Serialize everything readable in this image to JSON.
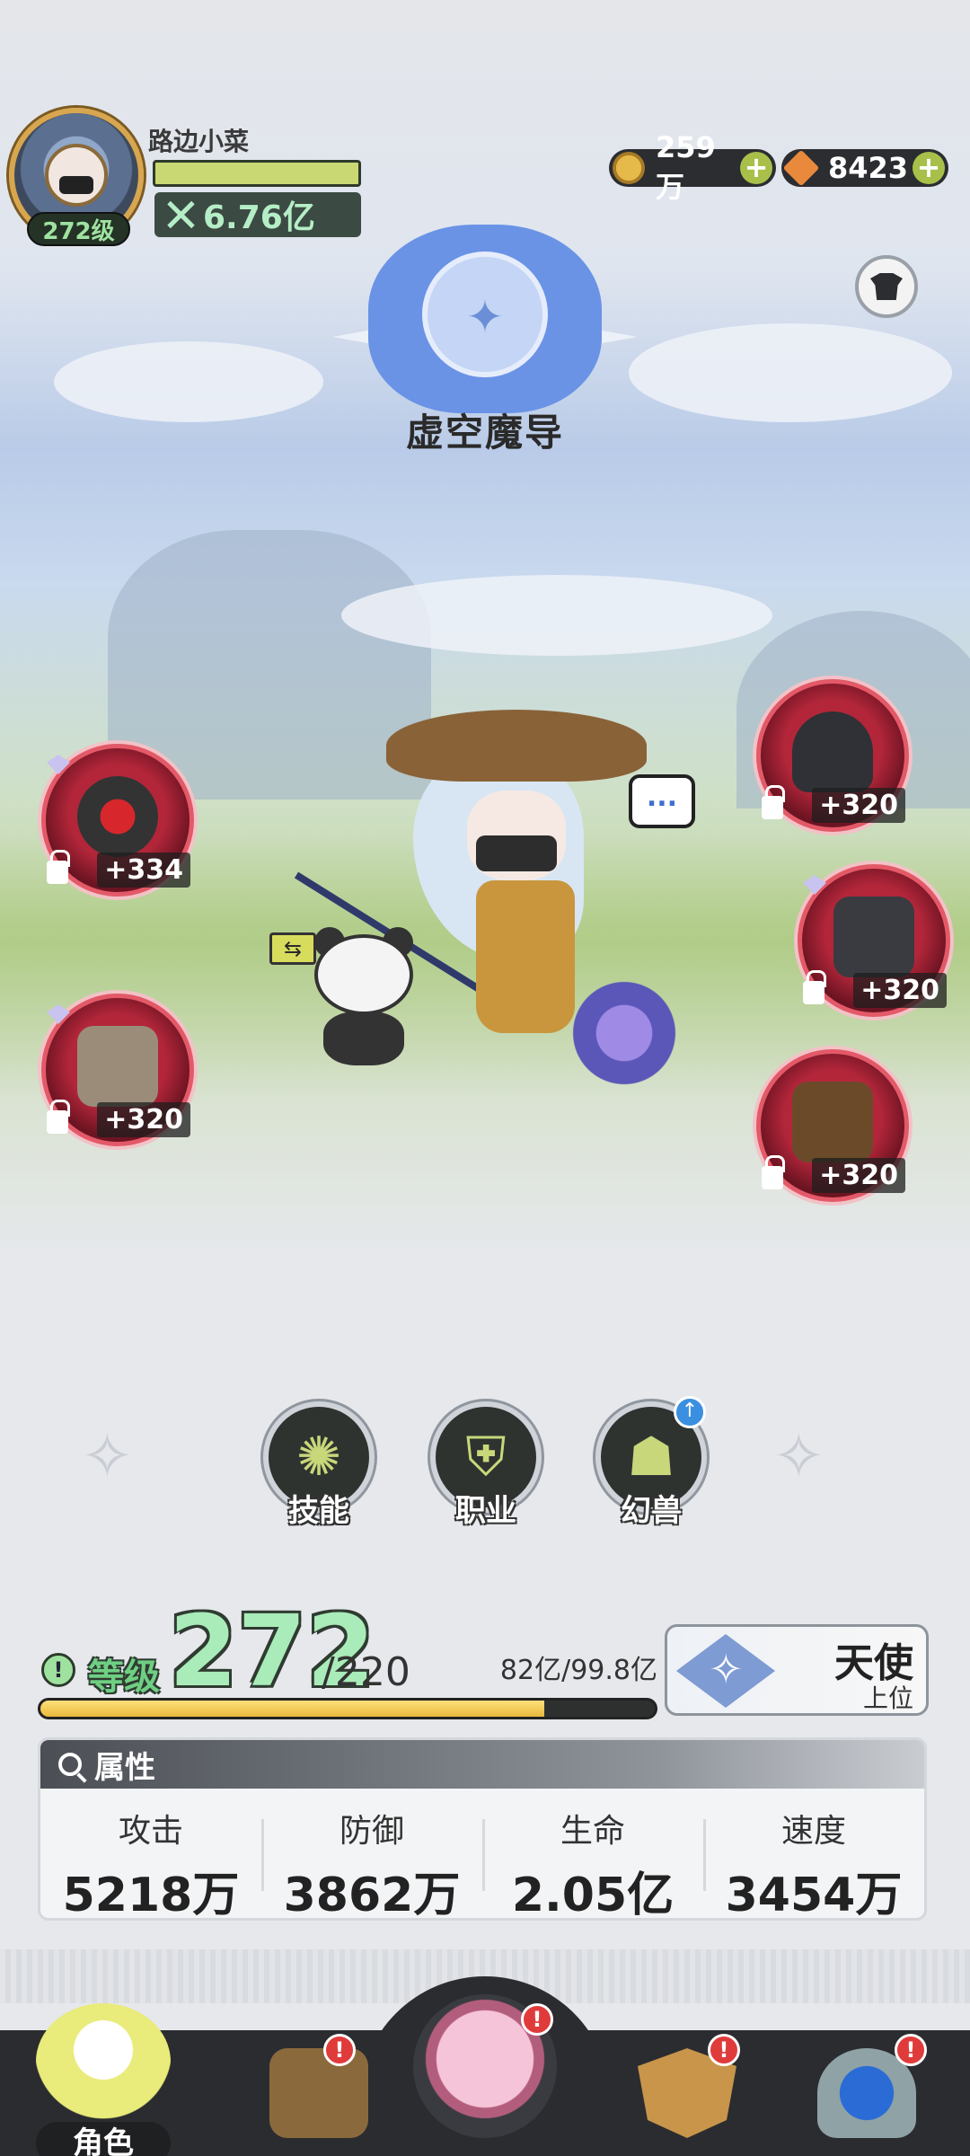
{
  "player": {
    "name": "路边小菜",
    "level_badge": "272级",
    "power": "6.76亿"
  },
  "currencies": {
    "gold": "259万",
    "gems": "8423"
  },
  "class": {
    "name": "虚空魔导"
  },
  "scene": {
    "speech_bubble": "...",
    "swap_icon": "⇆"
  },
  "equipment": [
    {
      "slot": "weapon",
      "level": "+334"
    },
    {
      "slot": "book",
      "level": "+320"
    },
    {
      "slot": "headband",
      "level": "+320"
    },
    {
      "slot": "armor",
      "level": "+320"
    },
    {
      "slot": "boots",
      "level": "+320"
    }
  ],
  "menu": {
    "skills": "技能",
    "profession": "职业",
    "beast": "幻兽"
  },
  "level": {
    "label": "等级",
    "current": "272",
    "max": "/220",
    "exp": "82亿/99.8亿",
    "exp_fraction": 0.82
  },
  "rank": {
    "title": "天使",
    "sub": "上位"
  },
  "attributes": {
    "header": "属性",
    "items": [
      {
        "name": "攻击",
        "value": "5218万"
      },
      {
        "name": "防御",
        "value": "3862万"
      },
      {
        "name": "生命",
        "value": "2.05亿"
      },
      {
        "name": "速度",
        "value": "3454万"
      }
    ]
  },
  "nav": {
    "role_label": "角色",
    "alert_mark": "!"
  },
  "colors": {
    "accent_green": "#a9ecb9",
    "slot_red": "#b3263a",
    "exp_yellow": "#e9b93c",
    "alert_red": "#e03b3b"
  }
}
